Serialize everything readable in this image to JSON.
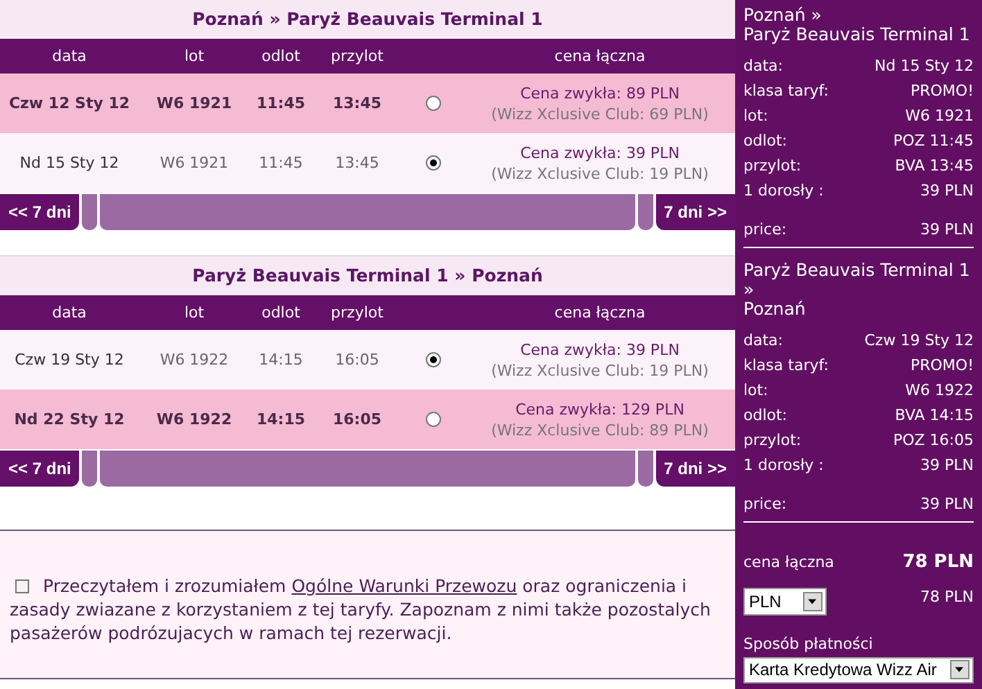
{
  "flights": [
    {
      "title": "Poznań » Paryż Beauvais Terminal 1",
      "columns": [
        "data",
        "lot",
        "odlot",
        "przylot",
        "",
        "cena łączna"
      ],
      "rows": [
        {
          "date": "Czw 12 Sty 12",
          "flight": "W6 1921",
          "departure": "11:45",
          "arrival": "13:45",
          "selected": false,
          "price": "Cena zwykła: 89 PLN",
          "club_price": "(Wizz Xclusive Club: 69 PLN)"
        },
        {
          "date": "Nd 15 Sty 12",
          "flight": "W6 1921",
          "departure": "11:45",
          "arrival": "13:45",
          "selected": true,
          "price": "Cena zwykła: 39 PLN",
          "club_price": "(Wizz Xclusive Club: 19 PLN)"
        }
      ],
      "prev": "<< 7 dni",
      "next": "7 dni >>"
    },
    {
      "title": "Paryż Beauvais Terminal 1 » Poznań",
      "columns": [
        "data",
        "lot",
        "odlot",
        "przylot",
        "",
        "cena łączna"
      ],
      "rows": [
        {
          "date": "Czw 19 Sty 12",
          "flight": "W6 1922",
          "departure": "14:15",
          "arrival": "16:05",
          "selected": true,
          "price": "Cena zwykła: 39 PLN",
          "club_price": "(Wizz Xclusive Club: 19 PLN)"
        },
        {
          "date": "Nd 22 Sty 12",
          "flight": "W6 1922",
          "departure": "14:15",
          "arrival": "16:05",
          "selected": false,
          "price": "Cena zwykła: 129 PLN",
          "club_price": "(Wizz Xclusive Club: 89 PLN)"
        }
      ],
      "prev": "<< 7 dni",
      "next": "7 dni >>"
    }
  ],
  "terms": {
    "checked": false,
    "text_before": "Przeczytałem i zrozumiałem",
    "link": "Ogólne Warunki Przewozu",
    "text_after": "oraz ograniczenia i zasady zwiazane z korzystaniem z tej taryfy. Zapoznam z nimi także pozostalych pasażerów podrózujacych w ramach tej rezerwacji."
  },
  "summary": {
    "legs": [
      {
        "title_lines": [
          "Poznań »",
          "Paryż Beauvais Terminal 1"
        ],
        "fields": [
          {
            "label": "data:",
            "value": "Nd 15 Sty 12"
          },
          {
            "label": "klasa taryf:",
            "value": "PROMO!"
          },
          {
            "label": "lot:",
            "value": "W6 1921"
          },
          {
            "label": "odlot:",
            "value": "POZ 11:45"
          },
          {
            "label": "przylot:",
            "value": "BVA 13:45"
          },
          {
            "label": "1 dorosły :",
            "value": "39 PLN"
          }
        ],
        "price_label": "price:",
        "price": "39 PLN"
      },
      {
        "title_lines": [
          "Paryż Beauvais Terminal 1",
          "»",
          "Poznań"
        ],
        "fields": [
          {
            "label": "data:",
            "value": "Czw 19 Sty 12"
          },
          {
            "label": "klasa taryf:",
            "value": "PROMO!"
          },
          {
            "label": "lot:",
            "value": "W6 1922"
          },
          {
            "label": "odlot:",
            "value": "BVA 14:15"
          },
          {
            "label": "przylot:",
            "value": "POZ 16:05"
          },
          {
            "label": "1 dorosły :",
            "value": "39 PLN"
          }
        ],
        "price_label": "price:",
        "price": "39 PLN"
      }
    ],
    "total_label": "cena łączna",
    "total": "78 PLN",
    "currency": {
      "value": "PLN"
    },
    "currency_total": "78 PLN",
    "payment_label": "Sposób płatności",
    "payment": {
      "value": "Karta Kredytowa Wizz Air"
    }
  }
}
